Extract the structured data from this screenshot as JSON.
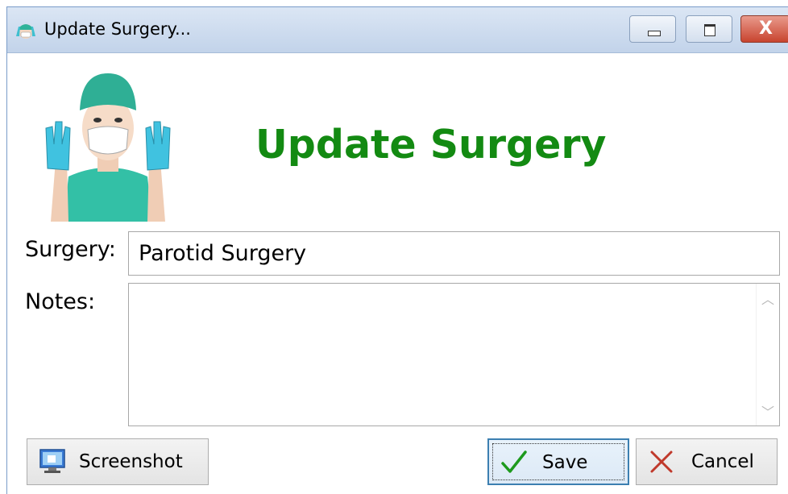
{
  "window": {
    "title": "Update Surgery...",
    "icon": "nurse-icon",
    "controls": {
      "minimize": "minimize-icon",
      "maximize": "maximize-icon",
      "close": "close-icon",
      "close_glyph": "X"
    }
  },
  "header": {
    "heading": "Update Surgery",
    "heading_color": "#138a12",
    "image": "surgeon-illustration"
  },
  "form": {
    "surgery_label": "Surgery:",
    "surgery_value": "Parotid Surgery",
    "notes_label": "Notes:",
    "notes_value": ""
  },
  "buttons": {
    "screenshot": {
      "label": "Screenshot",
      "icon": "monitor-icon"
    },
    "save": {
      "label": "Save",
      "icon": "checkmark-icon",
      "accent": "#3c7fb1"
    },
    "cancel": {
      "label": "Cancel",
      "icon": "x-icon"
    }
  }
}
